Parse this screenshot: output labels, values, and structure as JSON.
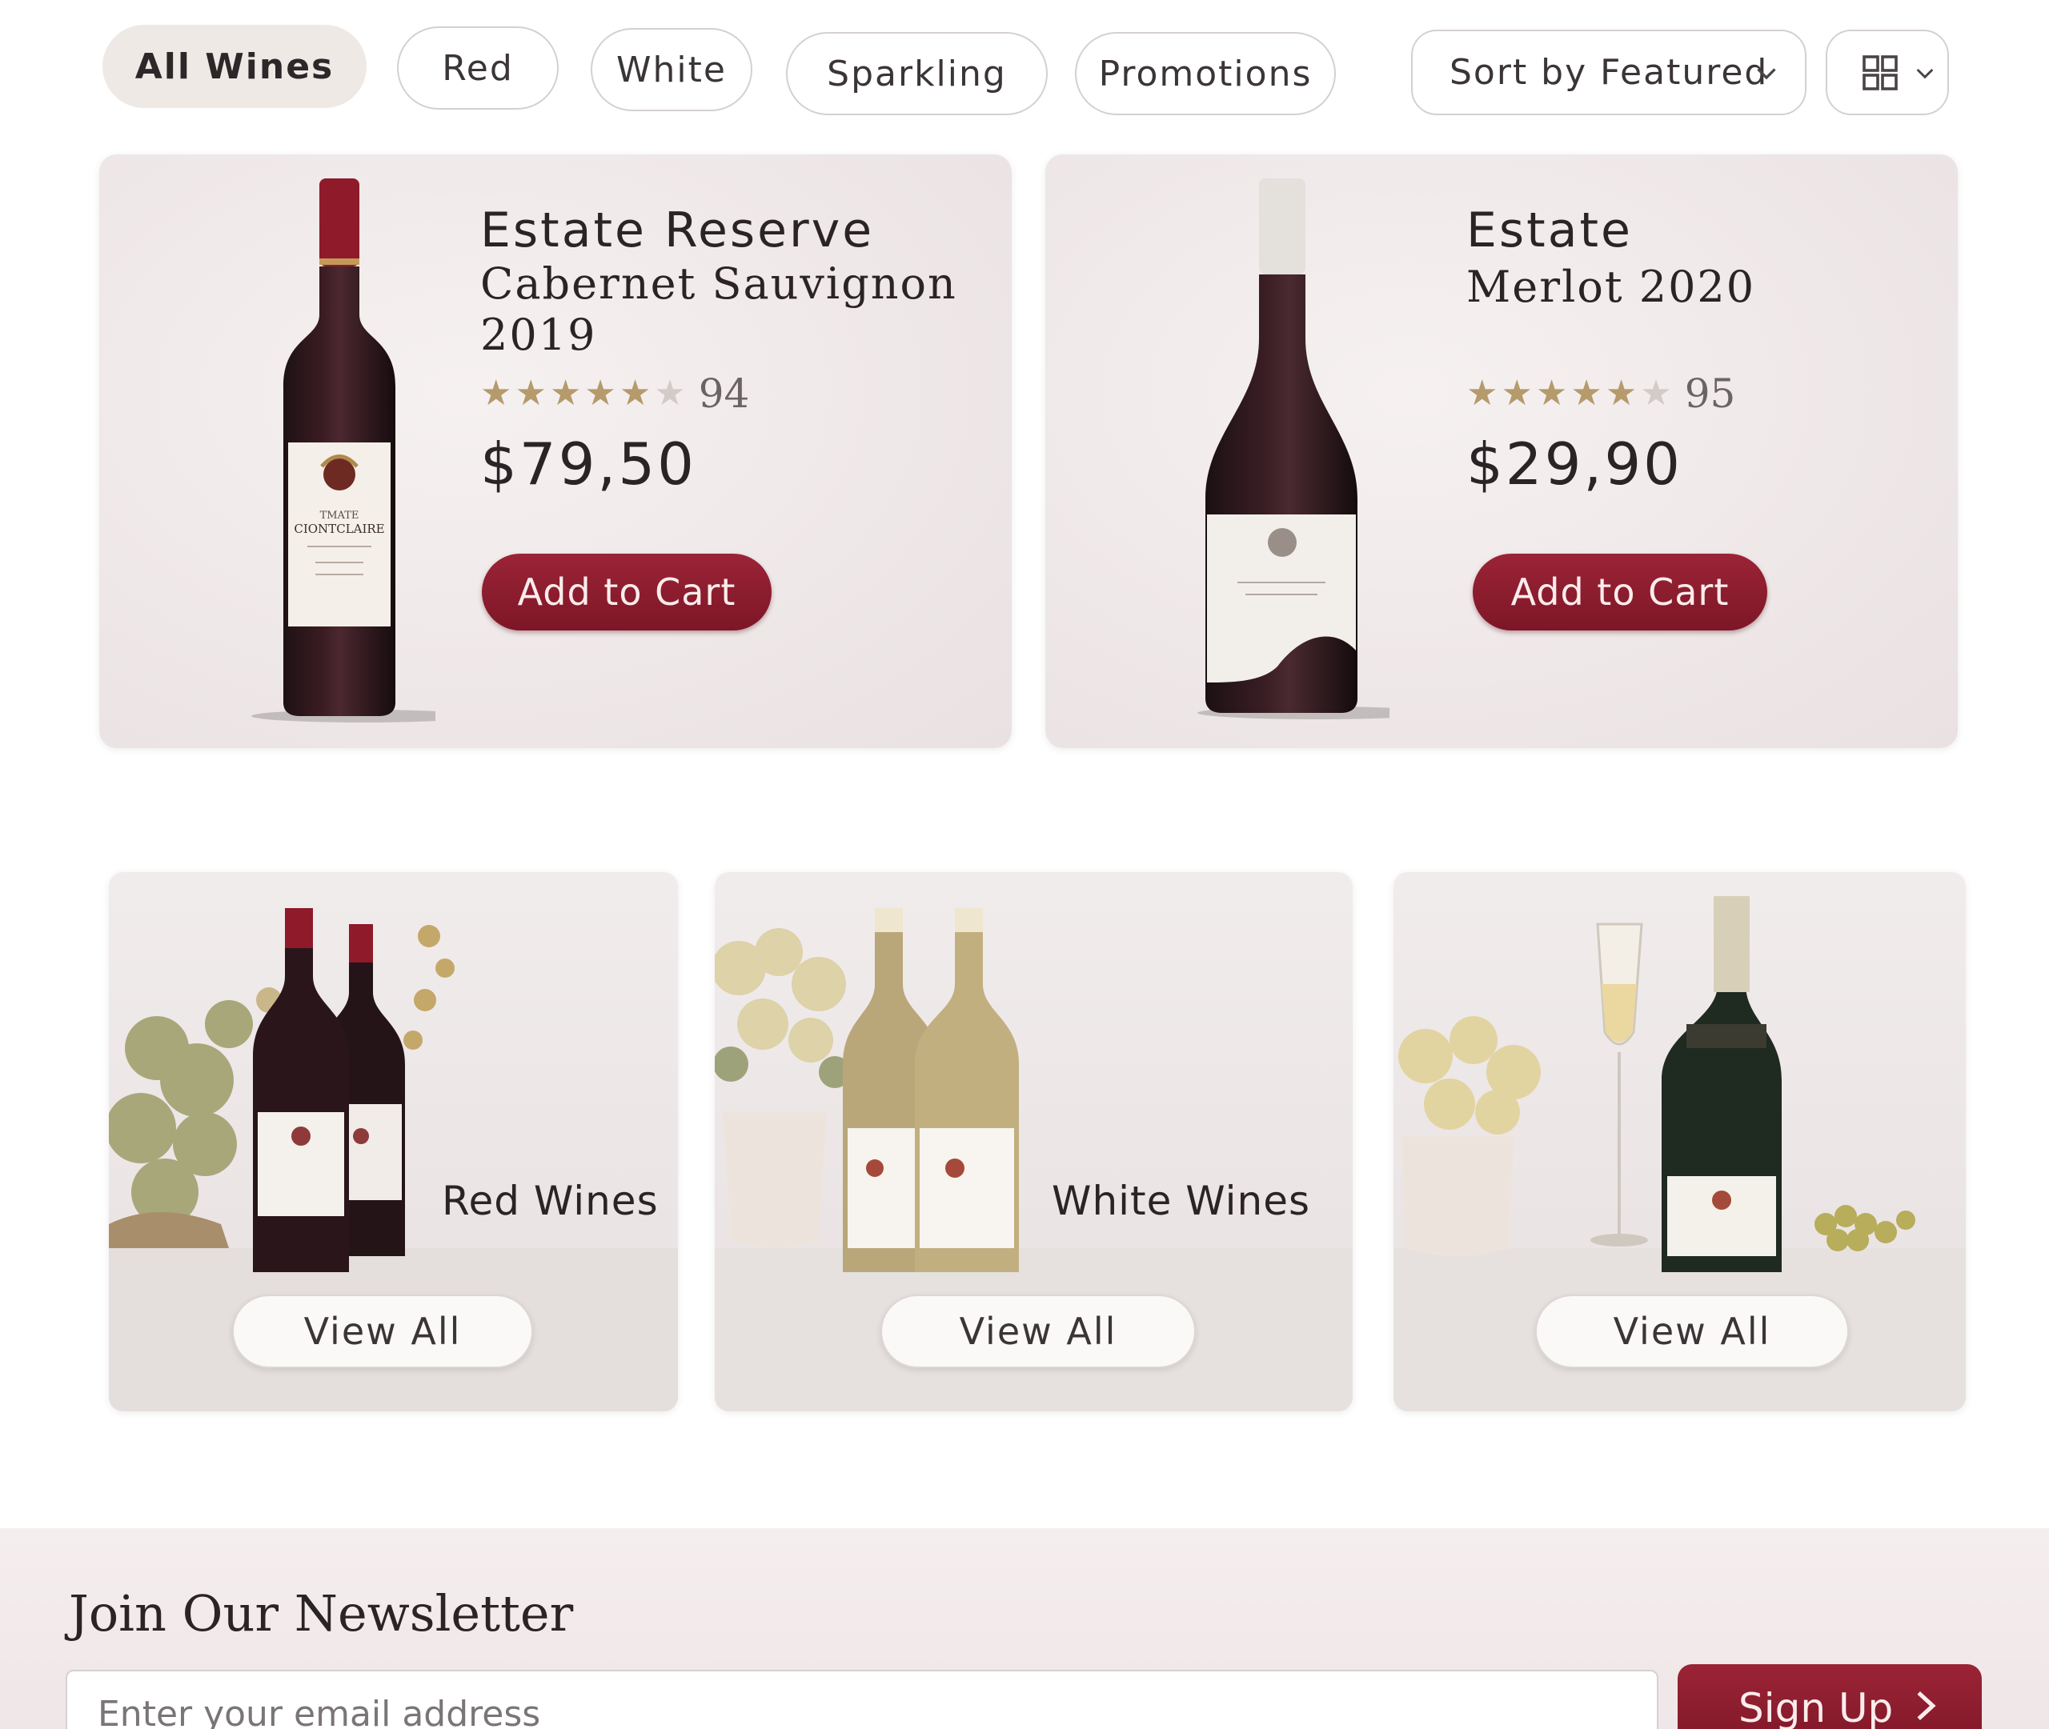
{
  "filters": {
    "all": "All Wines",
    "red": "Red",
    "white": "White",
    "sparkling": "Sparkling",
    "promotions": "Promotions",
    "active": "All Wines"
  },
  "sort": {
    "label": "Sort by Featured"
  },
  "products": [
    {
      "title_line1": "Estate Reserve",
      "title_line2": "Cabernet Sauvignon",
      "title_line3": "2019",
      "rating_stars": 4.5,
      "rating": "94",
      "price": "$79,50",
      "cart_label": "Add to Cart",
      "bottle_label_line1": "TMATE",
      "bottle_label_line2": "CIONTCLAIRE"
    },
    {
      "title_line1": "Estate",
      "title_line2": "Merlot 2020",
      "rating_stars": 4.5,
      "rating": "95",
      "price": "$29,90",
      "cart_label": "Add to Cart"
    }
  ],
  "categories": [
    {
      "label": "Red Wines",
      "button": "View All"
    },
    {
      "label": "White Wines",
      "button": "View All"
    },
    {
      "label": "",
      "button": "View All"
    }
  ],
  "newsletter": {
    "title": "Join Our Newsletter",
    "placeholder": "Enter your email address",
    "button": "Sign Up"
  },
  "colors": {
    "accent": "#8a1c2e",
    "pill_active": "#efe9e5",
    "star": "#b59a6b",
    "card_bg": "#efe8e8"
  }
}
